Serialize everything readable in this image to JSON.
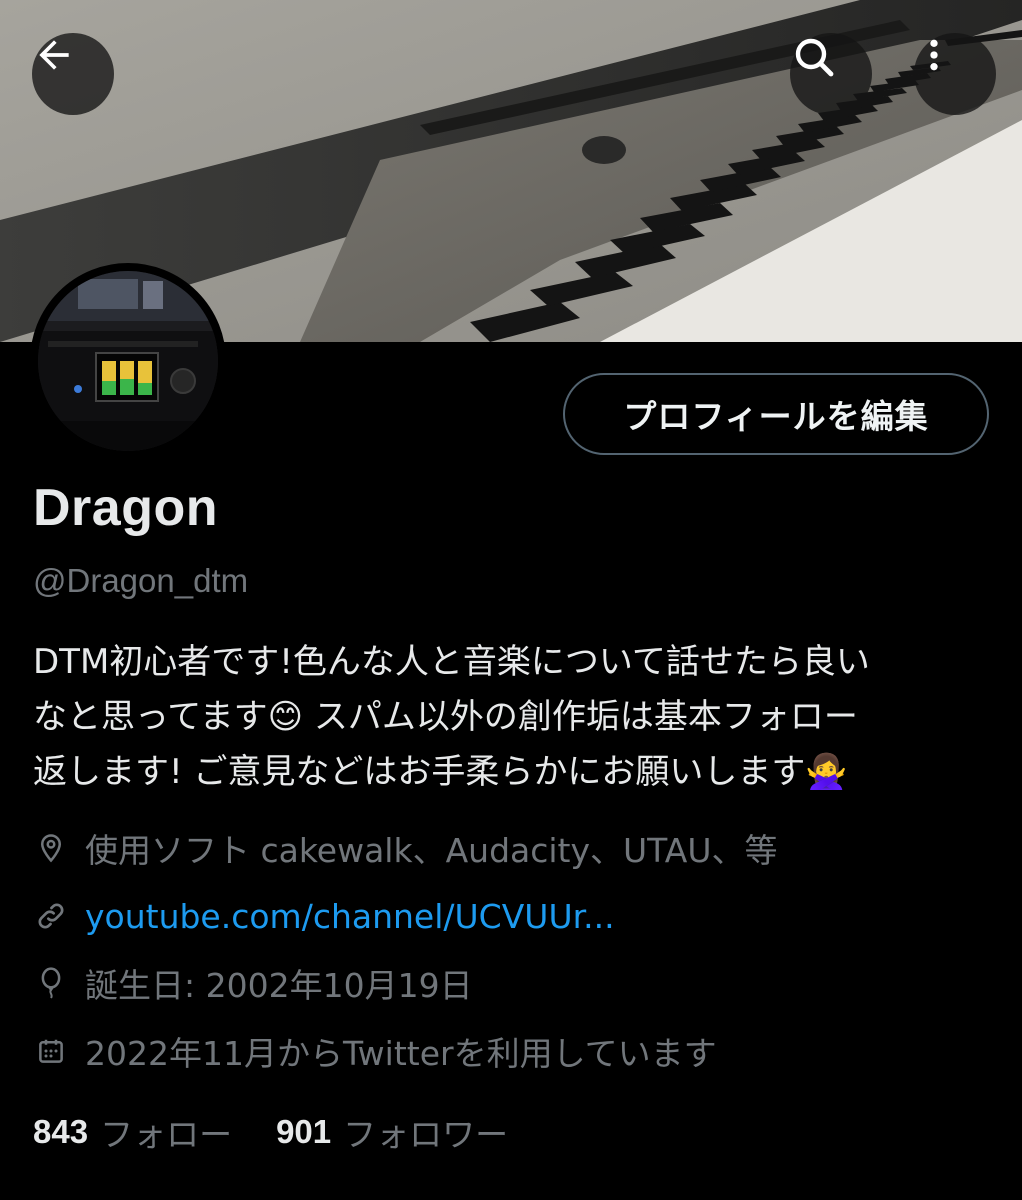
{
  "header": {
    "back_icon": "arrow-left-icon",
    "search_icon": "search-icon",
    "more_icon": "more-vertical-icon"
  },
  "profile": {
    "display_name": "Dragon",
    "handle": "@Dragon_dtm",
    "edit_button_label": "プロフィールを編集",
    "bio": "DTM初心者です!色んな人と音楽について話せたら良い\nなと思ってます😊 スパム以外の創作垢は基本フォロー\n返します! ご意見などはお手柔らかにお願いします🙅‍♀️",
    "location": "使用ソフト cakewalk、Audacity、UTAU、等",
    "link": "youtube.com/channel/UCVUUr...",
    "birthday": "誕生日: 2002年10月19日",
    "joined": "2022年11月からTwitterを利用しています"
  },
  "stats": {
    "following_count": "843",
    "following_label": "フォロー",
    "followers_count": "901",
    "followers_label": "フォロワー"
  },
  "colors": {
    "background": "#000000",
    "text_primary": "#e7e9ea",
    "text_secondary": "#71767b",
    "link": "#1d9bf0",
    "border": "#536471"
  }
}
